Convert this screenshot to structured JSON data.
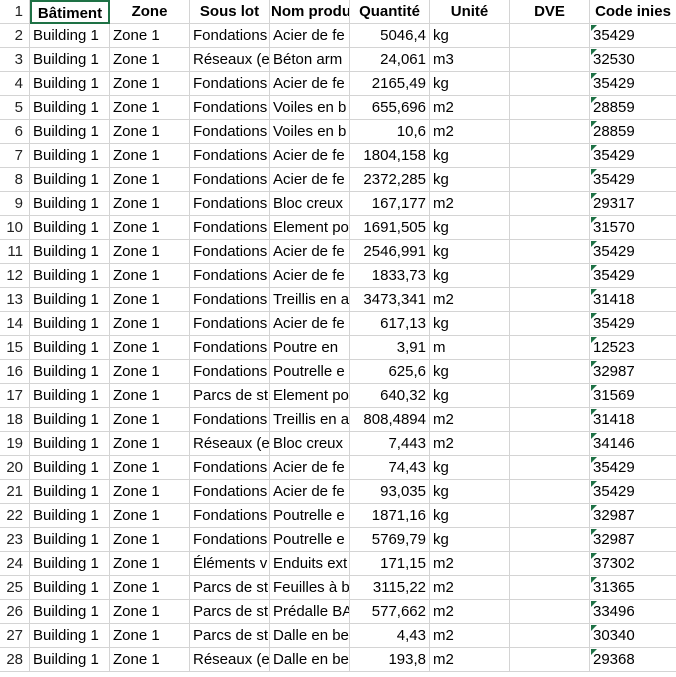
{
  "header": {
    "row_number": "1",
    "columns": [
      "Bâtiment",
      "Zone",
      "Sous lot",
      "Nom produi",
      "Quantité",
      "Unité",
      "DVE",
      "Code inies"
    ]
  },
  "rows": [
    {
      "n": "2",
      "bat": "Building 1",
      "zone": "Zone 1",
      "sous": "Fondations",
      "nom": "Acier de fe",
      "qte": "5046,4",
      "unite": "kg",
      "dve": "",
      "code": "35429"
    },
    {
      "n": "3",
      "bat": "Building 1",
      "zone": "Zone 1",
      "sous": "Réseaux (e",
      "nom": "Béton arm",
      "qte": "24,061",
      "unite": "m3",
      "dve": "",
      "code": "32530"
    },
    {
      "n": "4",
      "bat": "Building 1",
      "zone": "Zone 1",
      "sous": "Fondations",
      "nom": "Acier de fe",
      "qte": "2165,49",
      "unite": "kg",
      "dve": "",
      "code": "35429"
    },
    {
      "n": "5",
      "bat": "Building 1",
      "zone": "Zone 1",
      "sous": "Fondations",
      "nom": "Voiles en b",
      "qte": "655,696",
      "unite": "m2",
      "dve": "",
      "code": "28859"
    },
    {
      "n": "6",
      "bat": "Building 1",
      "zone": "Zone 1",
      "sous": "Fondations",
      "nom": "Voiles en b",
      "qte": "10,6",
      "unite": "m2",
      "dve": "",
      "code": "28859"
    },
    {
      "n": "7",
      "bat": "Building 1",
      "zone": "Zone 1",
      "sous": "Fondations",
      "nom": "Acier de fe",
      "qte": "1804,158",
      "unite": "kg",
      "dve": "",
      "code": "35429"
    },
    {
      "n": "8",
      "bat": "Building 1",
      "zone": "Zone 1",
      "sous": "Fondations",
      "nom": "Acier de fe",
      "qte": "2372,285",
      "unite": "kg",
      "dve": "",
      "code": "35429"
    },
    {
      "n": "9",
      "bat": "Building 1",
      "zone": "Zone 1",
      "sous": "Fondations",
      "nom": "Bloc creux",
      "qte": "167,177",
      "unite": "m2",
      "dve": "",
      "code": "29317"
    },
    {
      "n": "10",
      "bat": "Building 1",
      "zone": "Zone 1",
      "sous": "Fondations",
      "nom": "Element po",
      "qte": "1691,505",
      "unite": "kg",
      "dve": "",
      "code": "31570"
    },
    {
      "n": "11",
      "bat": "Building 1",
      "zone": "Zone 1",
      "sous": "Fondations",
      "nom": "Acier de fe",
      "qte": "2546,991",
      "unite": "kg",
      "dve": "",
      "code": "35429"
    },
    {
      "n": "12",
      "bat": "Building 1",
      "zone": "Zone 1",
      "sous": "Fondations",
      "nom": "Acier de fe",
      "qte": "1833,73",
      "unite": "kg",
      "dve": "",
      "code": "35429"
    },
    {
      "n": "13",
      "bat": "Building 1",
      "zone": "Zone 1",
      "sous": "Fondations",
      "nom": "Treillis en a",
      "qte": "3473,341",
      "unite": "m2",
      "dve": "",
      "code": "31418"
    },
    {
      "n": "14",
      "bat": "Building 1",
      "zone": "Zone 1",
      "sous": "Fondations",
      "nom": "Acier de fe",
      "qte": "617,13",
      "unite": "kg",
      "dve": "",
      "code": "35429"
    },
    {
      "n": "15",
      "bat": "Building 1",
      "zone": "Zone 1",
      "sous": "Fondations",
      "nom": "Poutre en",
      "qte": "3,91",
      "unite": "m",
      "dve": "",
      "code": "12523"
    },
    {
      "n": "16",
      "bat": "Building 1",
      "zone": "Zone 1",
      "sous": "Fondations",
      "nom": "Poutrelle e",
      "qte": "625,6",
      "unite": "kg",
      "dve": "",
      "code": "32987"
    },
    {
      "n": "17",
      "bat": "Building 1",
      "zone": "Zone 1",
      "sous": "Parcs de st",
      "nom": "Element po",
      "qte": "640,32",
      "unite": "kg",
      "dve": "",
      "code": "31569"
    },
    {
      "n": "18",
      "bat": "Building 1",
      "zone": "Zone 1",
      "sous": "Fondations",
      "nom": "Treillis en a",
      "qte": "808,4894",
      "unite": "m2",
      "dve": "",
      "code": "31418"
    },
    {
      "n": "19",
      "bat": "Building 1",
      "zone": "Zone 1",
      "sous": "Réseaux (e",
      "nom": "Bloc creux",
      "qte": "7,443",
      "unite": "m2",
      "dve": "",
      "code": "34146"
    },
    {
      "n": "20",
      "bat": "Building 1",
      "zone": "Zone 1",
      "sous": "Fondations",
      "nom": "Acier de fe",
      "qte": "74,43",
      "unite": "kg",
      "dve": "",
      "code": "35429"
    },
    {
      "n": "21",
      "bat": "Building 1",
      "zone": "Zone 1",
      "sous": "Fondations",
      "nom": "Acier de fe",
      "qte": "93,035",
      "unite": "kg",
      "dve": "",
      "code": "35429"
    },
    {
      "n": "22",
      "bat": "Building 1",
      "zone": "Zone 1",
      "sous": "Fondations",
      "nom": "Poutrelle e",
      "qte": "1871,16",
      "unite": "kg",
      "dve": "",
      "code": "32987"
    },
    {
      "n": "23",
      "bat": "Building 1",
      "zone": "Zone 1",
      "sous": "Fondations",
      "nom": "Poutrelle e",
      "qte": "5769,79",
      "unite": "kg",
      "dve": "",
      "code": "32987"
    },
    {
      "n": "24",
      "bat": "Building 1",
      "zone": "Zone 1",
      "sous": "Éléments v",
      "nom": "Enduits ext",
      "qte": "171,15",
      "unite": "m2",
      "dve": "",
      "code": "37302"
    },
    {
      "n": "25",
      "bat": "Building 1",
      "zone": "Zone 1",
      "sous": "Parcs de st",
      "nom": "Feuilles à b",
      "qte": "3115,22",
      "unite": "m2",
      "dve": "",
      "code": "31365"
    },
    {
      "n": "26",
      "bat": "Building 1",
      "zone": "Zone 1",
      "sous": "Parcs de st",
      "nom": "Prédalle BA",
      "qte": "577,662",
      "unite": "m2",
      "dve": "",
      "code": "33496"
    },
    {
      "n": "27",
      "bat": "Building 1",
      "zone": "Zone 1",
      "sous": "Parcs de st",
      "nom": "Dalle en be",
      "qte": "4,43",
      "unite": "m2",
      "dve": "",
      "code": "30340"
    },
    {
      "n": "28",
      "bat": "Building 1",
      "zone": "Zone 1",
      "sous": "Réseaux (e",
      "nom": "Dalle en be",
      "qte": "193,8",
      "unite": "m2",
      "dve": "",
      "code": "29368"
    }
  ],
  "colors": {
    "grid": "#d4d4d4",
    "selection": "#1e7145",
    "error_flag": "#1e7145"
  }
}
